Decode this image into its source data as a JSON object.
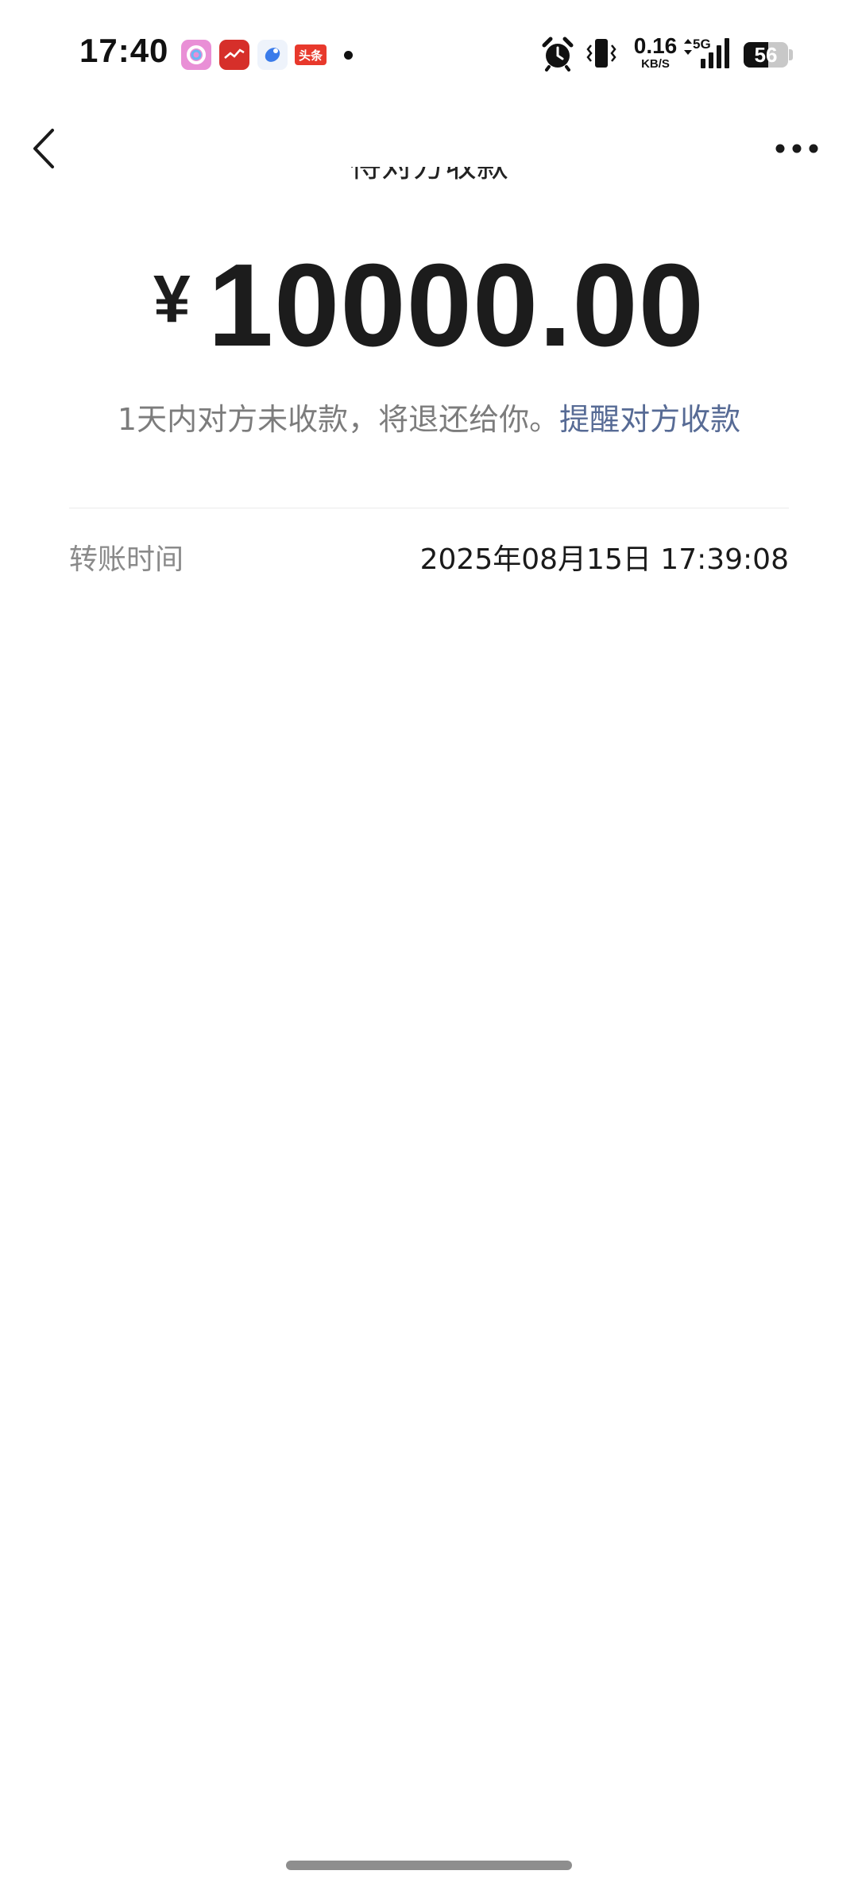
{
  "status_bar": {
    "time": "17:40",
    "toutiao_label": "头条",
    "net_speed_value": "0.16",
    "net_speed_unit": "KB/S",
    "network_type": "5G",
    "battery_level": "56",
    "notification_icons": [
      "photos-app-icon",
      "red-app-icon",
      "blue-app-icon",
      "toutiao-app-icon"
    ],
    "right_icons": [
      "alarm-clock-icon",
      "vibrate-icon",
      "data-arrows-icon",
      "signal-bars-icon",
      "battery-icon"
    ]
  },
  "nav": {
    "back_icon": "chevron-left-icon",
    "more_icon": "more-dots-icon"
  },
  "transfer": {
    "status_title": "待对方收款",
    "currency_symbol": "¥",
    "amount": "10000.00",
    "notice_text": "1天内对方未收款，将退还给你。",
    "remind_link": "提醒对方收款",
    "time_label": "转账时间",
    "time_value": "2025年08月15日 17:39:08"
  },
  "colors": {
    "link": "#576b95",
    "muted_text": "#7c7c7c",
    "amount_text": "#1c1c1c",
    "divider": "#ebebeb"
  }
}
